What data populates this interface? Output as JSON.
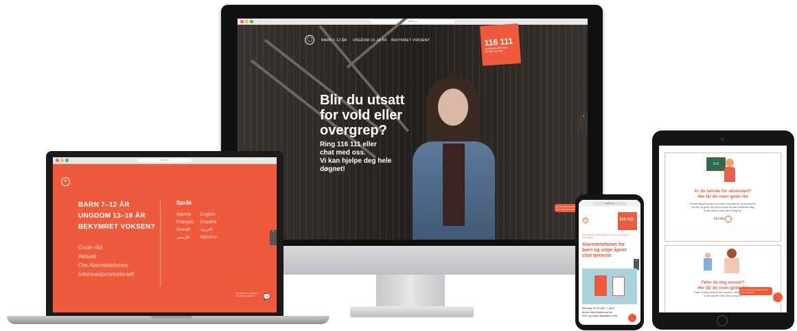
{
  "monitor": {
    "url": "116111.no",
    "nav": [
      "BARN 7–12 ÅR",
      "UNGDOM 13–18 ÅR",
      "BEKYMRET VOKSEN?"
    ],
    "logo_number": "116 111",
    "logo_name": "ALARMTELEFONEN",
    "logo_tagline": "for barn og unge",
    "hero_title": [
      "Blir du utsatt",
      "for vold eller",
      "overgrep?"
    ],
    "hero_sub": [
      "Ring 116 111 eller",
      "chat med oss.",
      "Vi kan hjelpe deg hele",
      "døgnet!"
    ],
    "chat_note": "Hei, har du en melding til oss? Skriv til oss her"
  },
  "laptop": {
    "url": "116111.no",
    "close_icon": "close-icon",
    "menu_main": [
      "BARN 7–12 ÅR",
      "UNGDOM 13–18 ÅR",
      "BEKYMRET VOKSEN?"
    ],
    "menu_secondary": [
      "Gode råd",
      "Aktuelt",
      "Om Alarmtelefonen",
      "Informasjonsmateriell"
    ],
    "lang_heading": "Språk",
    "languages_left": [
      "Samisk",
      "Français",
      "Somali",
      "فارسی"
    ],
    "languages_right": [
      "English",
      "Español",
      "العربية",
      "Nynorsk"
    ],
    "chat_note": "Hei, har du en melding til oss? Skriv til oss her"
  },
  "phone": {
    "url": "116111.no",
    "logo_number": "116 111",
    "breadcrumb": "Hjem / Aktuelt / Alarmtelefonen for barn og unge åpner chat tjeneste",
    "title": [
      "Alarmtelefonen for",
      "barn og unge åpner",
      "chat tjeneste"
    ],
    "body": [
      "Mandag 16.00 den 7. april",
      "åpner Alarmtelefonen for",
      "barn og unge døgnåpen chat"
    ]
  },
  "tablet": {
    "card1_title": [
      "Er du nervøs for skolestart?",
      "Her får du noen gode råd"
    ],
    "card1_text": [
      "Første dag på skolen kan være spennende og skummelt.",
      "Her får du gode råd om hvordan du kan forberede deg.",
      "Vi har samlet noen råd til deg her."
    ],
    "card1_link": "Få råd",
    "card2_title": [
      "Føler du deg ensom?",
      "Her får du noen gode råd"
    ],
    "card2_text": [
      "Føler du deg ensom eller utenfor i vennegjengen?",
      "Vi har samlet noen råd til deg her."
    ],
    "chat_note": "Hei, har du en melding til oss? Skriv til oss her"
  },
  "colors": {
    "accent": "#f05a3c",
    "dark": "#151515"
  }
}
